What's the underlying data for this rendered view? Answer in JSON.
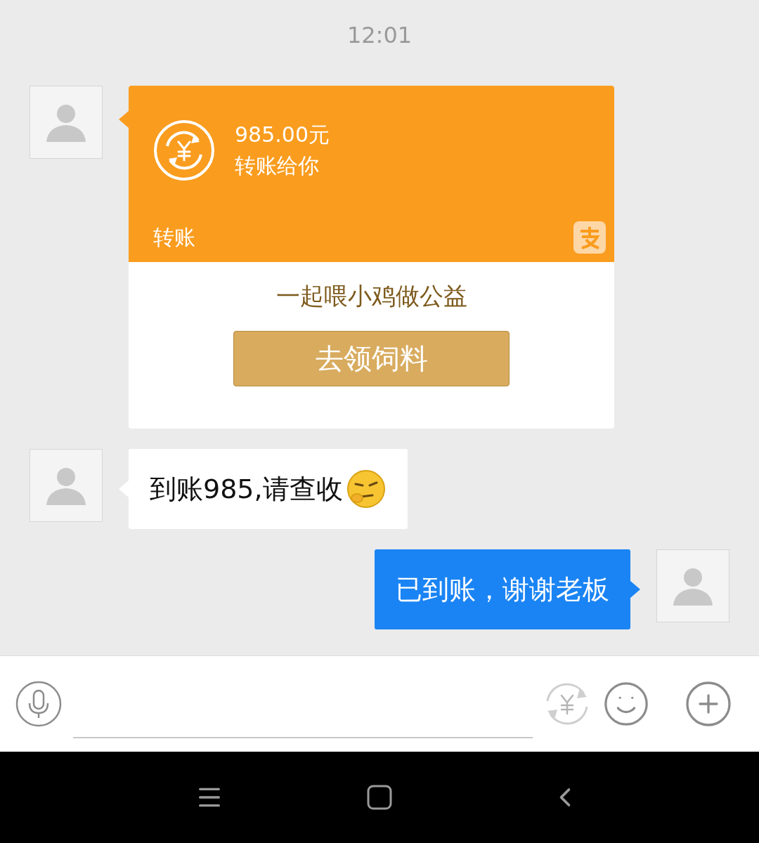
{
  "time": "12:01",
  "messages": [
    {
      "kind": "transfer",
      "outgoing": false,
      "amount": "985.00元",
      "note": "转账给你",
      "label": "转账",
      "promo": "一起喂小鸡做公益",
      "button": "去领饲料"
    },
    {
      "kind": "text",
      "outgoing": false,
      "text": "到账985,请查收",
      "emoji": true
    },
    {
      "kind": "text",
      "outgoing": true,
      "text": "已到账，谢谢老板",
      "emoji": false
    }
  ]
}
